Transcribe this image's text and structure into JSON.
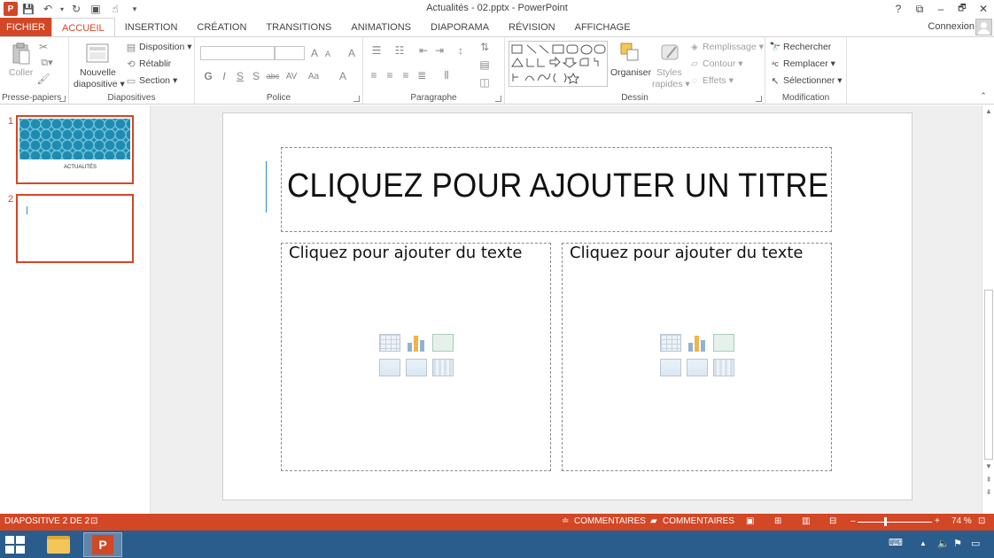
{
  "window": {
    "title": "Actualités - 02.pptx - PowerPoint",
    "help": "?",
    "ribbon_options": "⧉",
    "minimize": "–",
    "restore": "🗗",
    "close": "✕"
  },
  "qat": {
    "app_icon": "P",
    "save_icon": "💾",
    "undo_icon": "↶",
    "redo_icon": "↻",
    "present_icon": "▣",
    "touch_icon": "☝",
    "customize_icon": "▾"
  },
  "tabs": {
    "file": "FICHIER",
    "items": [
      "ACCUEIL",
      "INSERTION",
      "CRÉATION",
      "TRANSITIONS",
      "ANIMATIONS",
      "DIAPORAMA",
      "RÉVISION",
      "AFFICHAGE"
    ],
    "active": "ACCUEIL",
    "sign_in": "Connexion"
  },
  "ribbon": {
    "clipboard": {
      "label": "Presse-papiers",
      "paste": "Coller"
    },
    "slides": {
      "label": "Diapositives",
      "new_slide_1": "Nouvelle",
      "new_slide_2": "diapositive ▾",
      "layout": "Disposition ▾",
      "reset": "Rétablir",
      "section": "Section ▾"
    },
    "font": {
      "label": "Police",
      "bold": "G",
      "italic": "I",
      "underline": "S",
      "shadow": "S",
      "strike": "abc",
      "spacing": "AV",
      "case": "Aa",
      "grow": "A",
      "shrink": "A",
      "clear": "A",
      "color": "A"
    },
    "paragraph": {
      "label": "Paragraphe"
    },
    "drawing": {
      "label": "Dessin",
      "arrange": "Organiser",
      "styles_1": "Styles",
      "styles_2": "rapides ▾",
      "fill": "Remplissage ▾",
      "outline": "Contour ▾",
      "effects": "Effets ▾"
    },
    "editing": {
      "label": "Modification",
      "find": "Rechercher",
      "replace": "Remplacer ▾",
      "select": "Sélectionner ▾"
    }
  },
  "thumbnails": [
    {
      "number": "1",
      "title": "ACTUALITÉS"
    },
    {
      "number": "2",
      "title": ""
    }
  ],
  "slide": {
    "title_placeholder": "CLIQUEZ POUR AJOUTER UN TITRE",
    "left_placeholder": "Cliquez pour ajouter du texte",
    "right_placeholder": "Cliquez pour ajouter du texte"
  },
  "status": {
    "slide_info": "DIAPOSITIVE 2 DE 2",
    "notes": "COMMENTAIRES",
    "comments": "COMMENTAIRES",
    "zoom_minus": "–",
    "zoom_plus": "+",
    "zoom": "74 %"
  },
  "colors": {
    "accent": "#d24726",
    "taskbar": "#2b5d8c",
    "editor_bg": "#efefef"
  }
}
